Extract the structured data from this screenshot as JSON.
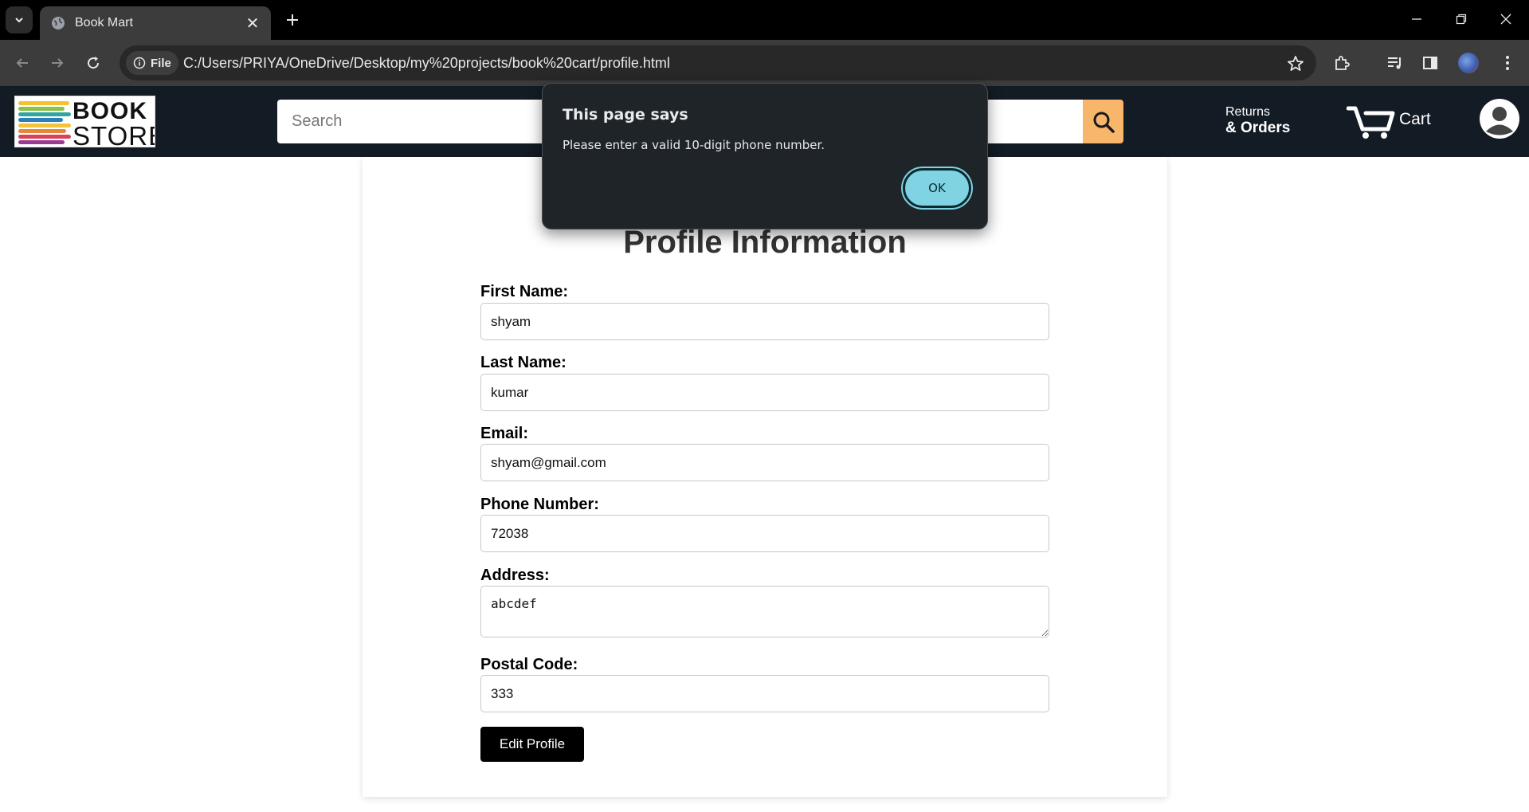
{
  "browser": {
    "tab_title": "Book Mart",
    "file_chip": "File",
    "url": "C:/Users/PRIYA/OneDrive/Desktop/my%20projects/book%20cart/profile.html"
  },
  "header": {
    "logo_line1": "BOOK",
    "logo_line2": "STORE",
    "search_placeholder": "Search",
    "returns_line1": "Returns",
    "returns_line2": "& Orders",
    "cart_label": "Cart"
  },
  "profile": {
    "title": "Profile Information",
    "first_name_label": "First Name:",
    "first_name_value": "shyam",
    "last_name_label": "Last Name:",
    "last_name_value": "kumar",
    "email_label": "Email:",
    "email_value": "shyam@gmail.com",
    "phone_label": "Phone Number:",
    "phone_value": "72038",
    "address_label": "Address:",
    "address_value": "abcdef",
    "postal_label": "Postal Code:",
    "postal_value": "333",
    "edit_button": "Edit Profile"
  },
  "dialog": {
    "title": "This page says",
    "message": "Please enter a valid 10-digit phone number.",
    "ok_label": "OK"
  },
  "colors": {
    "header_bg": "#131b25",
    "search_button": "#f8b66a",
    "dialog_bg": "#1f2428",
    "ok_button": "#7fd3e2"
  }
}
